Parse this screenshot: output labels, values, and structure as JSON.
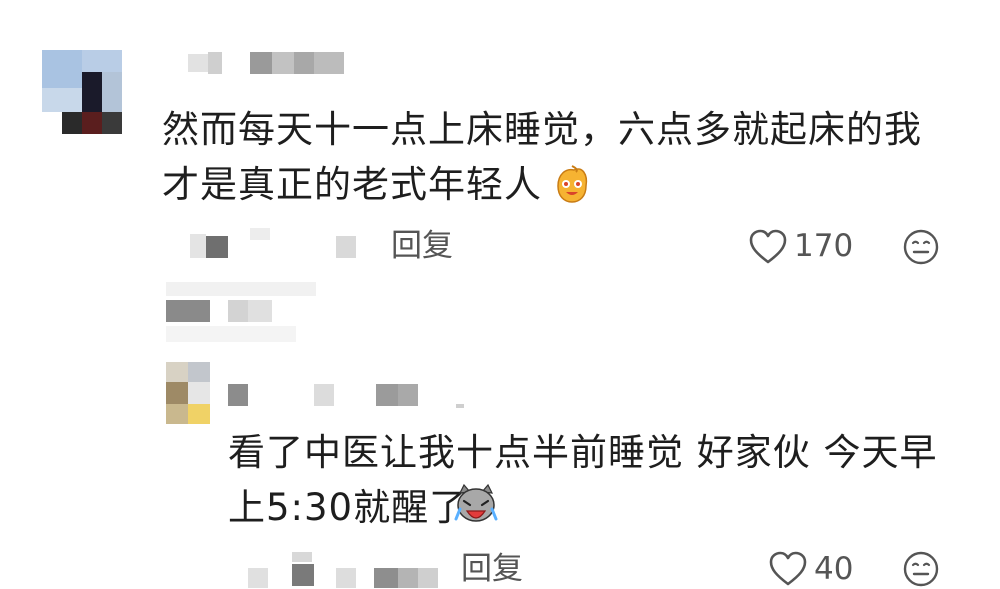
{
  "comments": [
    {
      "text_line1": "然而每天十一点上床睡觉，六点多就起床的我",
      "text_line2": "才是真正的老式年轻人",
      "emoji": "smile-emoji-icon",
      "reply_label": "回复",
      "like_count": "170"
    }
  ],
  "replies": [
    {
      "text_line1": "看了中医让我十点半前睡觉 好家伙 今天早",
      "text_line2": "上5:30就醒了",
      "emoji": "crying-cat-icon",
      "reply_label": "回复",
      "like_count": "40"
    }
  ],
  "colors": {
    "text": "#1e1e1e",
    "meta": "#555555",
    "blur_gray": "#c9c9c9"
  }
}
